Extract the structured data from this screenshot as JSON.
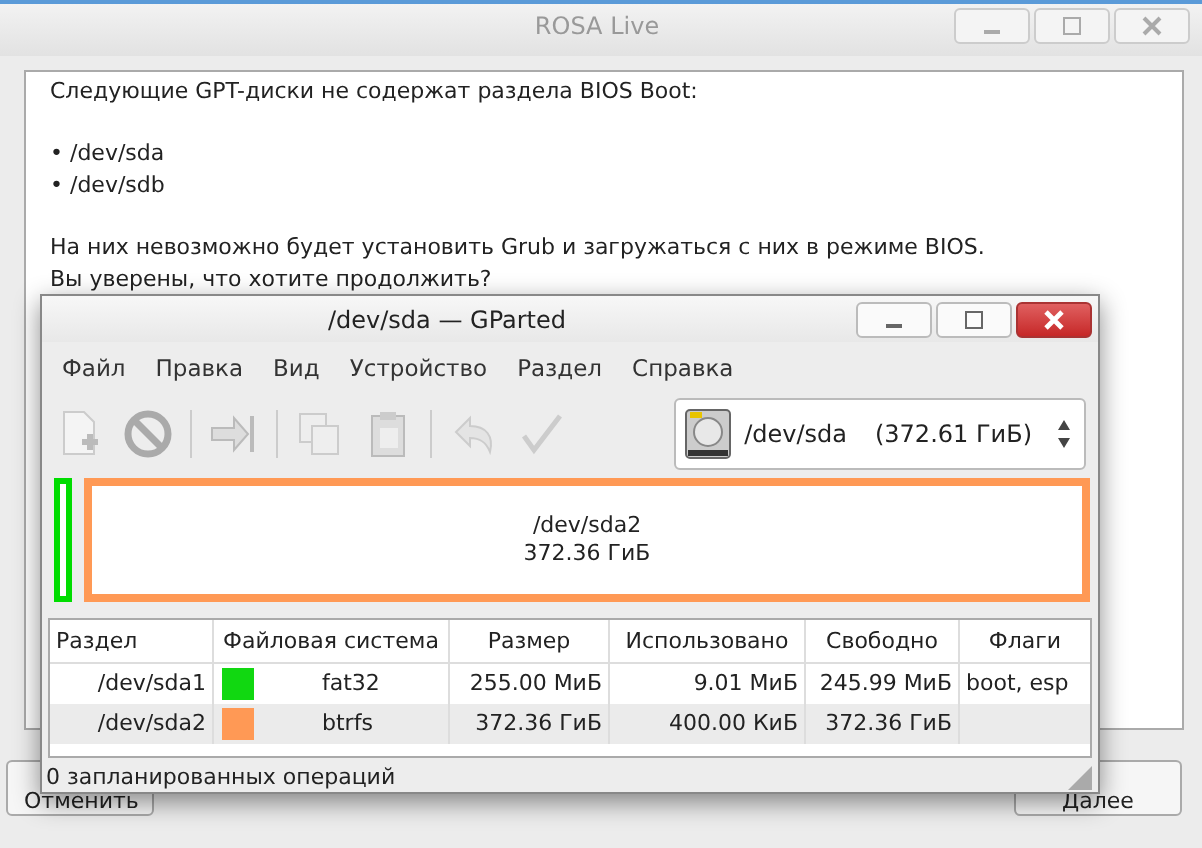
{
  "window": {
    "title": "ROSA Live"
  },
  "message": {
    "paragraphs": [
      [
        "Следующие GPT-диски не содержат раздела BIOS Boot:"
      ],
      [
        "• /dev/sda",
        "• /dev/sdb"
      ],
      [
        "На них невозможно будет установить Grub и загружаться с них в режиме BIOS.",
        "Вы уверены, что хотите продолжить?"
      ]
    ]
  },
  "buttons": [
    {
      "label": "Отменить",
      "kind": "cancel"
    },
    {
      "label": "Далее",
      "kind": "next"
    }
  ],
  "gparted": {
    "title": "/dev/sda — GParted",
    "menu": [
      "Файл",
      "Правка",
      "Вид",
      "Устройство",
      "Раздел",
      "Справка"
    ],
    "toolbar": [
      {
        "kind": "new",
        "disabled": true
      },
      {
        "kind": "delete",
        "disabled": true
      },
      {
        "kind": "sep"
      },
      {
        "kind": "resize",
        "disabled": true
      },
      {
        "kind": "sep"
      },
      {
        "kind": "copy",
        "disabled": true
      },
      {
        "kind": "paste",
        "disabled": true
      },
      {
        "kind": "sep"
      },
      {
        "kind": "undo",
        "disabled": true
      },
      {
        "kind": "apply",
        "disabled": true
      }
    ],
    "device": {
      "name": "/dev/sda",
      "size": "(372.61 ГиБ)"
    },
    "disk_map": [
      {
        "color": "#00dd00"
      },
      {
        "color": "#ff9955",
        "name": "/dev/sda2",
        "size": "372.36 ГиБ"
      }
    ],
    "table": {
      "columns": [
        "Раздел",
        "Файловая система",
        "Размер",
        "Использовано",
        "Свободно",
        "Флаги"
      ],
      "rows": [
        {
          "partition": "/dev/sda1",
          "color": "#11d811",
          "filesystem": "fat32",
          "size": "255.00 МиБ",
          "used": "9.01 МиБ",
          "free": "245.99 МиБ",
          "flags": "boot, esp"
        },
        {
          "partition": "/dev/sda2",
          "color": "#ff9955",
          "filesystem": "btrfs",
          "size": "372.36 ГиБ",
          "used": "400.00 КиБ",
          "free": "372.36 ГиБ"
        }
      ]
    },
    "status_bar": "0 запланированных операций"
  }
}
